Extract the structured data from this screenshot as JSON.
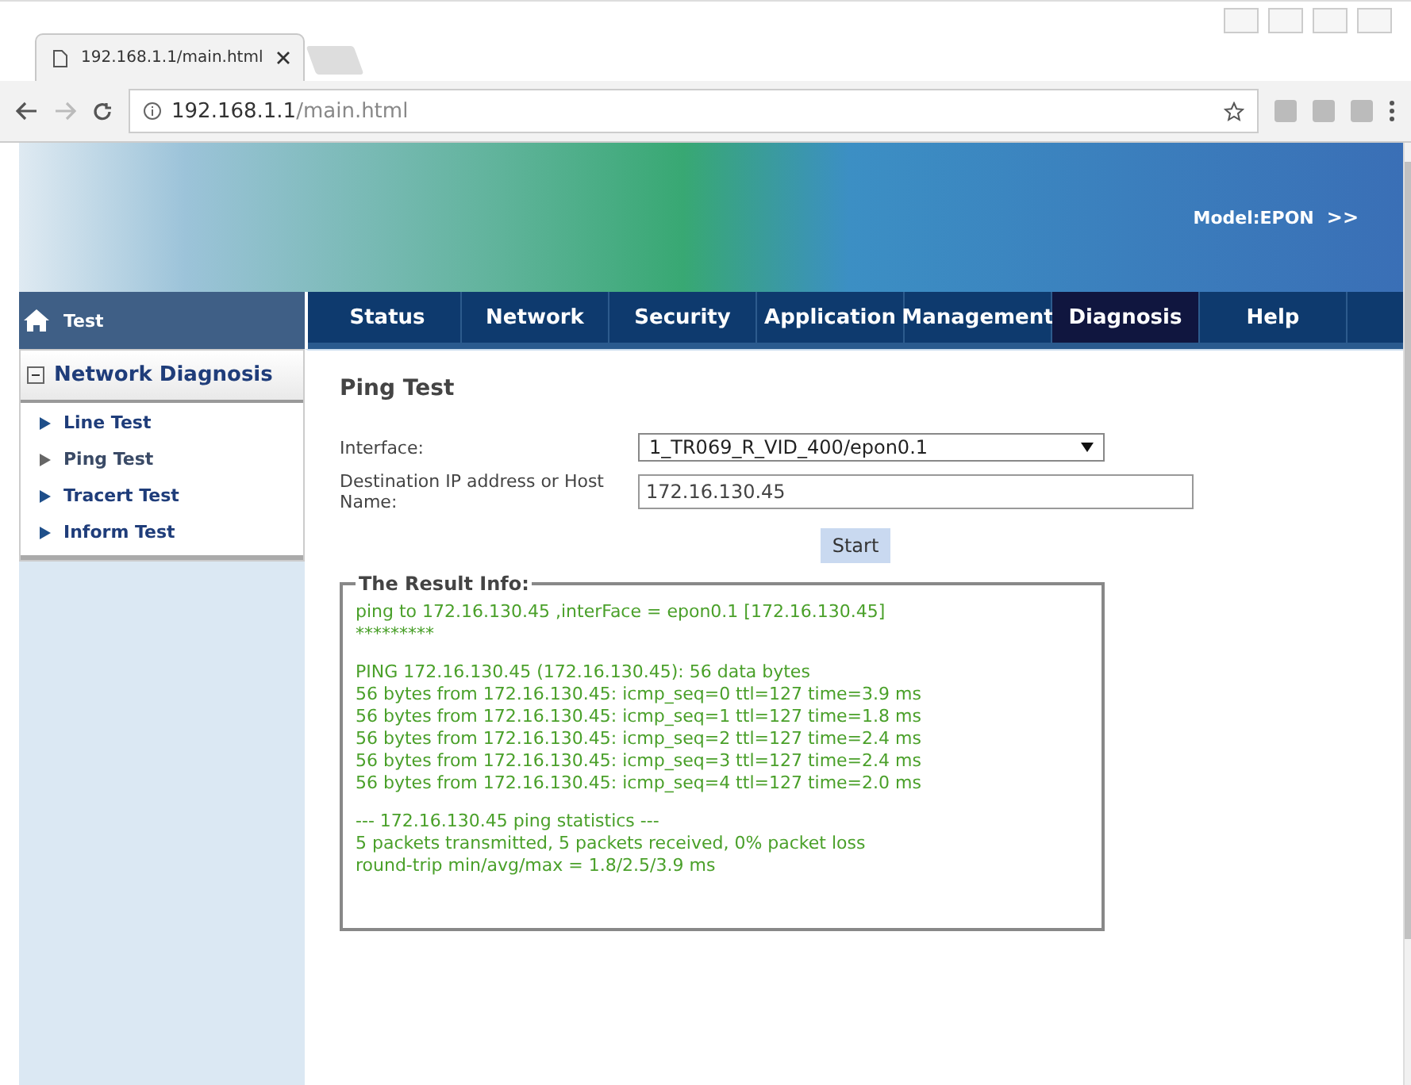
{
  "browser": {
    "tab_title": "192.168.1.1/main.html",
    "url_host": "192.168.1.1",
    "url_path": "/main.html"
  },
  "banner": {
    "model": "Model:EPON",
    "more": ">>"
  },
  "sidebar": {
    "title": "Test",
    "section": {
      "title": "Network Diagnosis",
      "expanded": true,
      "items": [
        {
          "label": "Line Test",
          "selected": false
        },
        {
          "label": "Ping Test",
          "selected": true
        },
        {
          "label": "Tracert Test",
          "selected": false
        },
        {
          "label": "Inform Test",
          "selected": false
        }
      ]
    }
  },
  "nav": [
    {
      "label": "Status",
      "selected": false
    },
    {
      "label": "Network",
      "selected": false
    },
    {
      "label": "Security",
      "selected": false
    },
    {
      "label": "Application",
      "selected": false
    },
    {
      "label": "Management",
      "selected": false
    },
    {
      "label": "Diagnosis",
      "selected": true
    },
    {
      "label": "Help",
      "selected": false
    }
  ],
  "content": {
    "title": "Ping Test",
    "interface": {
      "label": "Interface:",
      "value": "1_TR069_R_VID_400/epon0.1"
    },
    "destination": {
      "label": "Destination IP address or Host Name:",
      "value": "172.16.130.45"
    },
    "start_button": "Start",
    "result": {
      "legend": "The Result Info:",
      "blocks": [
        [
          "ping to 172.16.130.45 ,interFace = epon0.1 [172.16.130.45]",
          "*********"
        ],
        [
          "PING 172.16.130.45 (172.16.130.45): 56 data bytes",
          "56 bytes from 172.16.130.45: icmp_seq=0 ttl=127 time=3.9 ms",
          "56 bytes from 172.16.130.45: icmp_seq=1 ttl=127 time=1.8 ms",
          "56 bytes from 172.16.130.45: icmp_seq=2 ttl=127 time=2.4 ms",
          "56 bytes from 172.16.130.45: icmp_seq=3 ttl=127 time=2.4 ms",
          "56 bytes from 172.16.130.45: icmp_seq=4 ttl=127 time=2.0 ms"
        ],
        [
          "--- 172.16.130.45 ping statistics ---",
          "5 packets transmitted, 5 packets received, 0% packet loss",
          "round-trip min/avg/max = 1.8/2.5/3.9 ms"
        ]
      ]
    }
  }
}
